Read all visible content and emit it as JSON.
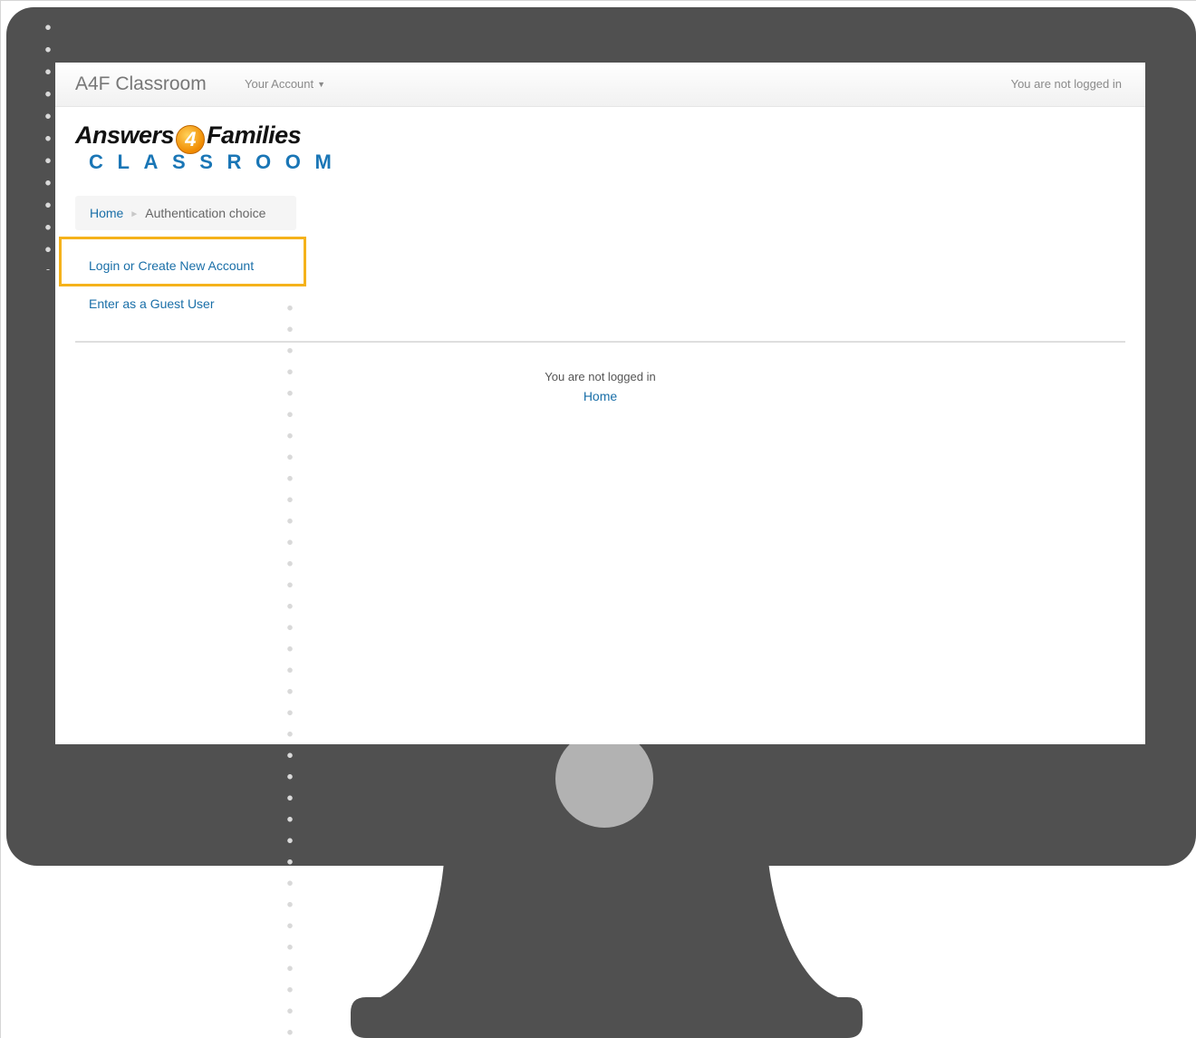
{
  "navbar": {
    "brand": "A4F Classroom",
    "account_menu": "Your Account",
    "status": "You are not logged in"
  },
  "logo": {
    "top_left": "Answers",
    "four": "4",
    "top_right": "Families",
    "bottom": "CLASSROOM"
  },
  "breadcrumb": {
    "home": "Home",
    "separator": "►",
    "current": "Authentication choice"
  },
  "links": {
    "login": "Login or Create New Account",
    "guest": "Enter as a Guest User"
  },
  "footer": {
    "status": "You are not logged in",
    "home": "Home"
  },
  "colors": {
    "monitor": "#505050",
    "highlight": "#f5b21b",
    "link": "#1a6fa8",
    "logo_blue": "#1a76b6",
    "power_button": "#b2b2b2"
  },
  "icons": {
    "dropdown": "caret-down-icon",
    "breadcrumb_separator": "triangle-right-icon"
  }
}
